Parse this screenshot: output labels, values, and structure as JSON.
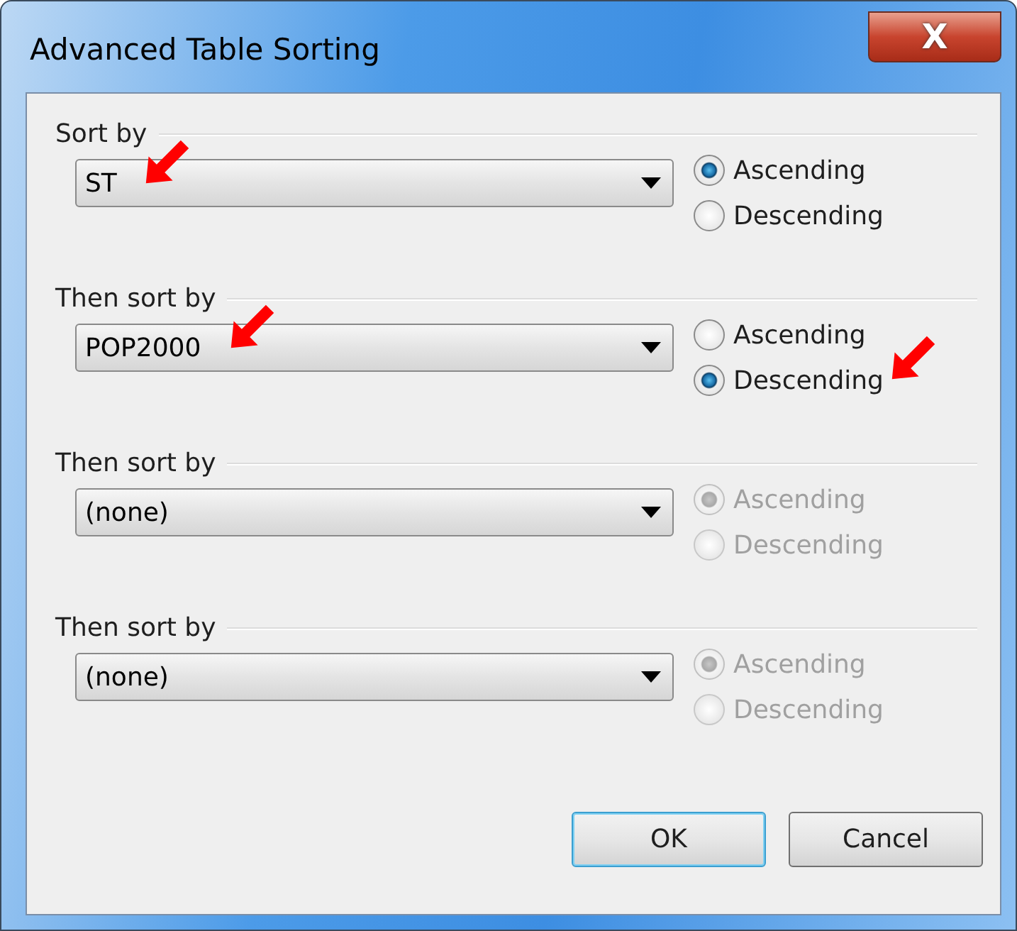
{
  "window": {
    "title": "Advanced Table Sorting",
    "close_label": "X"
  },
  "sort_levels": [
    {
      "label": "Sort by",
      "field": "ST",
      "disabled": false,
      "field_pointer": true,
      "options": [
        {
          "label": "Ascending",
          "selected": true,
          "pointer": false
        },
        {
          "label": "Descending",
          "selected": false,
          "pointer": false
        }
      ]
    },
    {
      "label": "Then sort by",
      "field": "POP2000",
      "disabled": false,
      "field_pointer": true,
      "options": [
        {
          "label": "Ascending",
          "selected": false,
          "pointer": false
        },
        {
          "label": "Descending",
          "selected": true,
          "pointer": true
        }
      ]
    },
    {
      "label": "Then sort by",
      "field": "(none)",
      "disabled": true,
      "field_pointer": false,
      "options": [
        {
          "label": "Ascending",
          "selected": true,
          "pointer": false
        },
        {
          "label": "Descending",
          "selected": false,
          "pointer": false
        }
      ]
    },
    {
      "label": "Then sort by",
      "field": "(none)",
      "disabled": true,
      "field_pointer": false,
      "options": [
        {
          "label": "Ascending",
          "selected": true,
          "pointer": false
        },
        {
          "label": "Descending",
          "selected": false,
          "pointer": false
        }
      ]
    }
  ],
  "buttons": [
    {
      "label": "OK",
      "default": true
    },
    {
      "label": "Cancel",
      "default": false
    }
  ]
}
